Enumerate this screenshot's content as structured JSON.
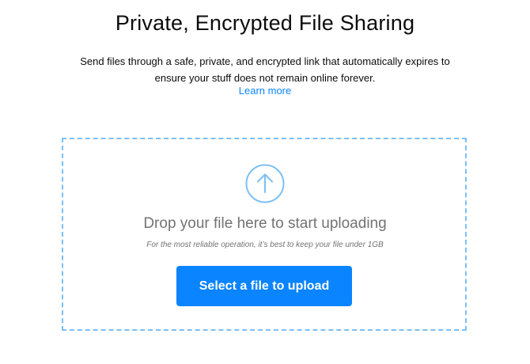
{
  "header": {
    "title": "Private, Encrypted File Sharing",
    "description": "Send files through a safe, private, and encrypted link that automatically expires to ensure your stuff does not remain online forever.",
    "learn_more": "Learn more"
  },
  "upload": {
    "icon": "upload-arrow-icon",
    "drop_text": "Drop your file here to start uploading",
    "note": "For the most reliable operation, it’s best to keep your file under 1GB",
    "button_label": "Select a file to upload"
  },
  "colors": {
    "accent": "#0a84ff",
    "dashed_border": "#7cc0f5",
    "muted_text": "#737373",
    "primary_text": "#0c0c0d"
  }
}
